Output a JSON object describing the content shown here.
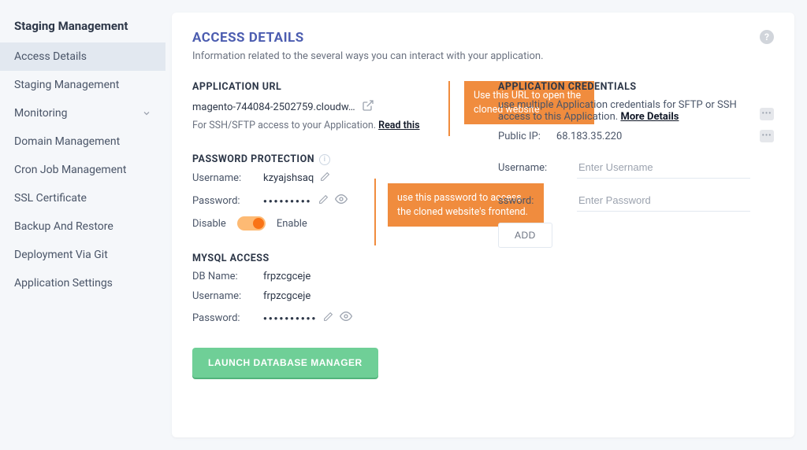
{
  "sidebar": {
    "title": "Staging Management",
    "items": [
      {
        "label": "Access Details",
        "active": true
      },
      {
        "label": "Staging Management"
      },
      {
        "label": "Monitoring",
        "expandable": true
      },
      {
        "label": "Domain Management"
      },
      {
        "label": "Cron Job Management"
      },
      {
        "label": "SSL Certificate"
      },
      {
        "label": "Backup And Restore"
      },
      {
        "label": "Deployment Via Git"
      },
      {
        "label": "Application Settings"
      }
    ]
  },
  "main": {
    "title": "ACCESS DETAILS",
    "subtitle": "Information related to the several ways you can interact with your application."
  },
  "appUrl": {
    "heading": "APPLICATION URL",
    "value": "magento-744084-2502759.cloudw…",
    "help_prefix": "For SSH/SFTP access to your Application. ",
    "help_link": "Read this"
  },
  "callouts": {
    "url": "Use this URL to open the cloned website",
    "password": "use this password to access the cloned website's frontend."
  },
  "passwordProtection": {
    "heading": "PASSWORD PROTECTION",
    "username_label": "Username:",
    "username_value": "kzyajshsaq",
    "password_label": "Password:",
    "password_value": "●●●●●●●●●",
    "disable_label": "Disable",
    "enable_label": "Enable"
  },
  "mysql": {
    "heading": "MYSQL ACCESS",
    "dbname_label": "DB Name:",
    "dbname_value": "frpzcgceje",
    "username_label": "Username:",
    "username_value": "frpzcgceje",
    "password_label": "Password:",
    "password_value": "●●●●●●●●●●",
    "launch_label": "LAUNCH DATABASE MANAGER"
  },
  "credentials": {
    "heading": "APPLICATION CREDENTIALS",
    "desc_prefix": "use multiple Application credentials for SFTP or SSH access to this Application. ",
    "desc_link": "More Details",
    "public_ip_label": "Public IP:",
    "public_ip_value": "68.183.35.220",
    "username_label": "Username:",
    "username_placeholder": "Enter Username",
    "password_label": "ssword:",
    "password_placeholder": "Enter Password",
    "add_label": "ADD"
  }
}
